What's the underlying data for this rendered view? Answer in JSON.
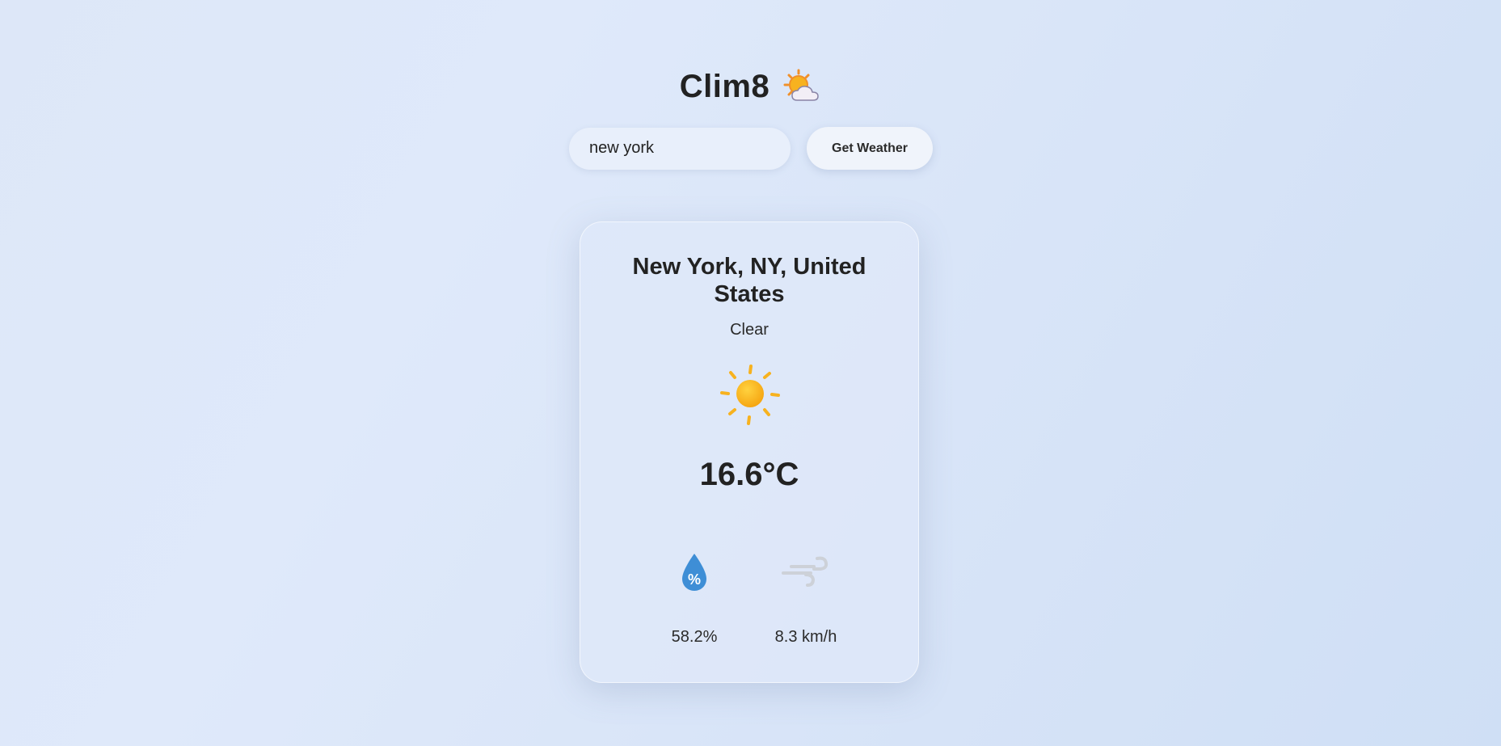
{
  "app": {
    "title": "Clim8",
    "title_icon": "sun-behind-cloud-icon"
  },
  "search": {
    "value": "new york",
    "placeholder": "",
    "button_label": "Get Weather"
  },
  "weather": {
    "location": "New York, NY, United States",
    "condition": "Clear",
    "condition_icon": "sun-icon",
    "temperature": "16.6°C",
    "humidity": "58.2%",
    "humidity_icon": "humidity-drop-icon",
    "wind": "8.3 km/h",
    "wind_icon": "wind-icon"
  },
  "colors": {
    "sun": "#f7b21f",
    "humidity_drop": "#3e8ed6",
    "wind": "#c9ced6"
  }
}
